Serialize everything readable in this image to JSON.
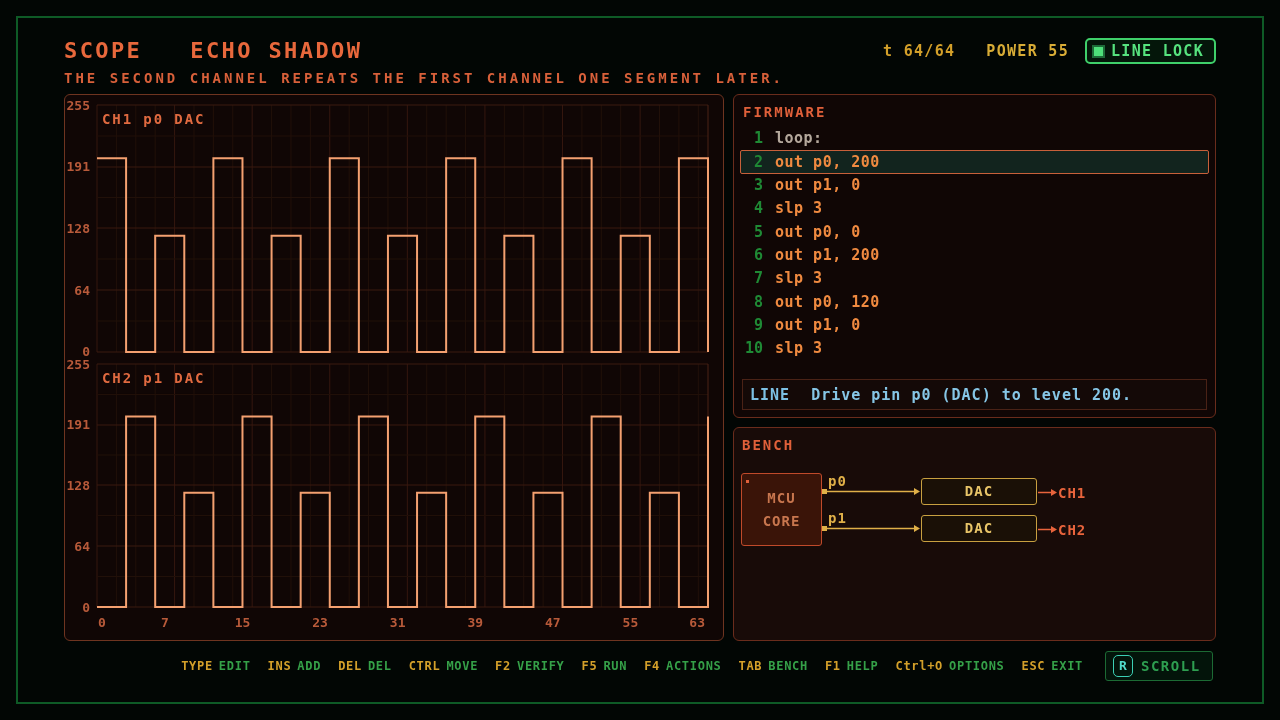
{
  "header": {
    "title": "SCOPE",
    "puzzle": "ECHO SHADOW",
    "subtitle": "THE SECOND CHANNEL REPEATS THE FIRST CHANNEL ONE SEGMENT LATER.",
    "time": "t 64/64",
    "power": "POWER 55",
    "line_lock": {
      "label": "LINE LOCK",
      "on": true
    }
  },
  "scope": {
    "charts": [
      {
        "chart_data": {
          "type": "line",
          "title": "CH1 p0 DAC",
          "x": [
            0,
            3,
            3,
            6,
            6,
            9,
            9,
            12,
            12,
            15,
            15,
            18,
            18,
            21,
            21,
            24,
            24,
            27,
            27,
            30,
            30,
            33,
            33,
            36,
            36,
            39,
            39,
            42,
            42,
            45,
            45,
            48,
            48,
            51,
            51,
            54,
            54,
            57,
            57,
            60,
            60,
            63,
            63
          ],
          "values": [
            200,
            200,
            0,
            0,
            120,
            120,
            0,
            0,
            200,
            200,
            0,
            0,
            120,
            120,
            0,
            0,
            200,
            200,
            0,
            0,
            120,
            120,
            0,
            0,
            200,
            200,
            0,
            0,
            120,
            120,
            0,
            0,
            200,
            200,
            0,
            0,
            120,
            120,
            0,
            0,
            200,
            200,
            0
          ],
          "xlim": [
            0,
            63
          ],
          "ylim": [
            0,
            255
          ],
          "yticks": [
            0,
            64,
            128,
            191,
            255
          ],
          "grid": true
        }
      },
      {
        "chart_data": {
          "type": "line",
          "title": "CH2 p1 DAC",
          "x": [
            0,
            3,
            3,
            6,
            6,
            9,
            9,
            12,
            12,
            15,
            15,
            18,
            18,
            21,
            21,
            24,
            24,
            27,
            27,
            30,
            30,
            33,
            33,
            36,
            36,
            39,
            39,
            42,
            42,
            45,
            45,
            48,
            48,
            51,
            51,
            54,
            54,
            57,
            57,
            60,
            60,
            63,
            63
          ],
          "values": [
            0,
            0,
            200,
            200,
            0,
            0,
            120,
            120,
            0,
            0,
            200,
            200,
            0,
            0,
            120,
            120,
            0,
            0,
            200,
            200,
            0,
            0,
            120,
            120,
            0,
            0,
            200,
            200,
            0,
            0,
            120,
            120,
            0,
            0,
            200,
            200,
            0,
            0,
            120,
            120,
            0,
            0,
            200
          ],
          "xlim": [
            0,
            63
          ],
          "ylim": [
            0,
            255
          ],
          "yticks": [
            0,
            64,
            128,
            191,
            255
          ],
          "xticks": [
            0,
            7,
            15,
            23,
            31,
            39,
            47,
            55,
            63
          ],
          "grid": true
        }
      }
    ]
  },
  "firmware": {
    "title": "FIRMWARE",
    "lines": [
      {
        "number": "1",
        "code": "loop:",
        "kind": "label",
        "selected": false
      },
      {
        "number": "2",
        "code": "out p0, 200",
        "kind": "instruction",
        "selected": true
      },
      {
        "number": "3",
        "code": "out p1, 0",
        "kind": "instruction",
        "selected": false
      },
      {
        "number": "4",
        "code": "slp 3",
        "kind": "instruction",
        "selected": false
      },
      {
        "number": "5",
        "code": "out p0, 0",
        "kind": "instruction",
        "selected": false
      },
      {
        "number": "6",
        "code": "out p1, 200",
        "kind": "instruction",
        "selected": false
      },
      {
        "number": "7",
        "code": "slp 3",
        "kind": "instruction",
        "selected": false
      },
      {
        "number": "8",
        "code": "out p0, 120",
        "kind": "instruction",
        "selected": false
      },
      {
        "number": "9",
        "code": "out p1, 0",
        "kind": "instruction",
        "selected": false
      },
      {
        "number": "10",
        "code": "slp 3",
        "kind": "instruction",
        "selected": false
      }
    ],
    "detail": {
      "label": "LINE",
      "text": "Drive pin p0 (DAC) to level 200."
    }
  },
  "bench": {
    "title": "BENCH",
    "mcu": {
      "lines": [
        "MCU",
        "CORE"
      ]
    },
    "pins": [
      {
        "label": "p0",
        "device": "DAC",
        "output": "CH1"
      },
      {
        "label": "p1",
        "device": "DAC",
        "output": "CH2"
      }
    ]
  },
  "footer": {
    "hints": [
      {
        "key": "TYPE",
        "action": "EDIT"
      },
      {
        "key": "INS",
        "action": "ADD"
      },
      {
        "key": "DEL",
        "action": "DEL"
      },
      {
        "key": "CTRL",
        "action": "MOVE"
      },
      {
        "key": "F2",
        "action": "VERIFY"
      },
      {
        "key": "F5",
        "action": "RUN"
      },
      {
        "key": "F4",
        "action": "ACTIONS"
      },
      {
        "key": "TAB",
        "action": "BENCH"
      },
      {
        "key": "F1",
        "action": "HELP"
      },
      {
        "key": "Ctrl+O",
        "action": "OPTIONS"
      },
      {
        "key": "ESC",
        "action": "EXIT"
      }
    ],
    "scroll_button": {
      "key": "R",
      "label": "SCROLL"
    }
  }
}
